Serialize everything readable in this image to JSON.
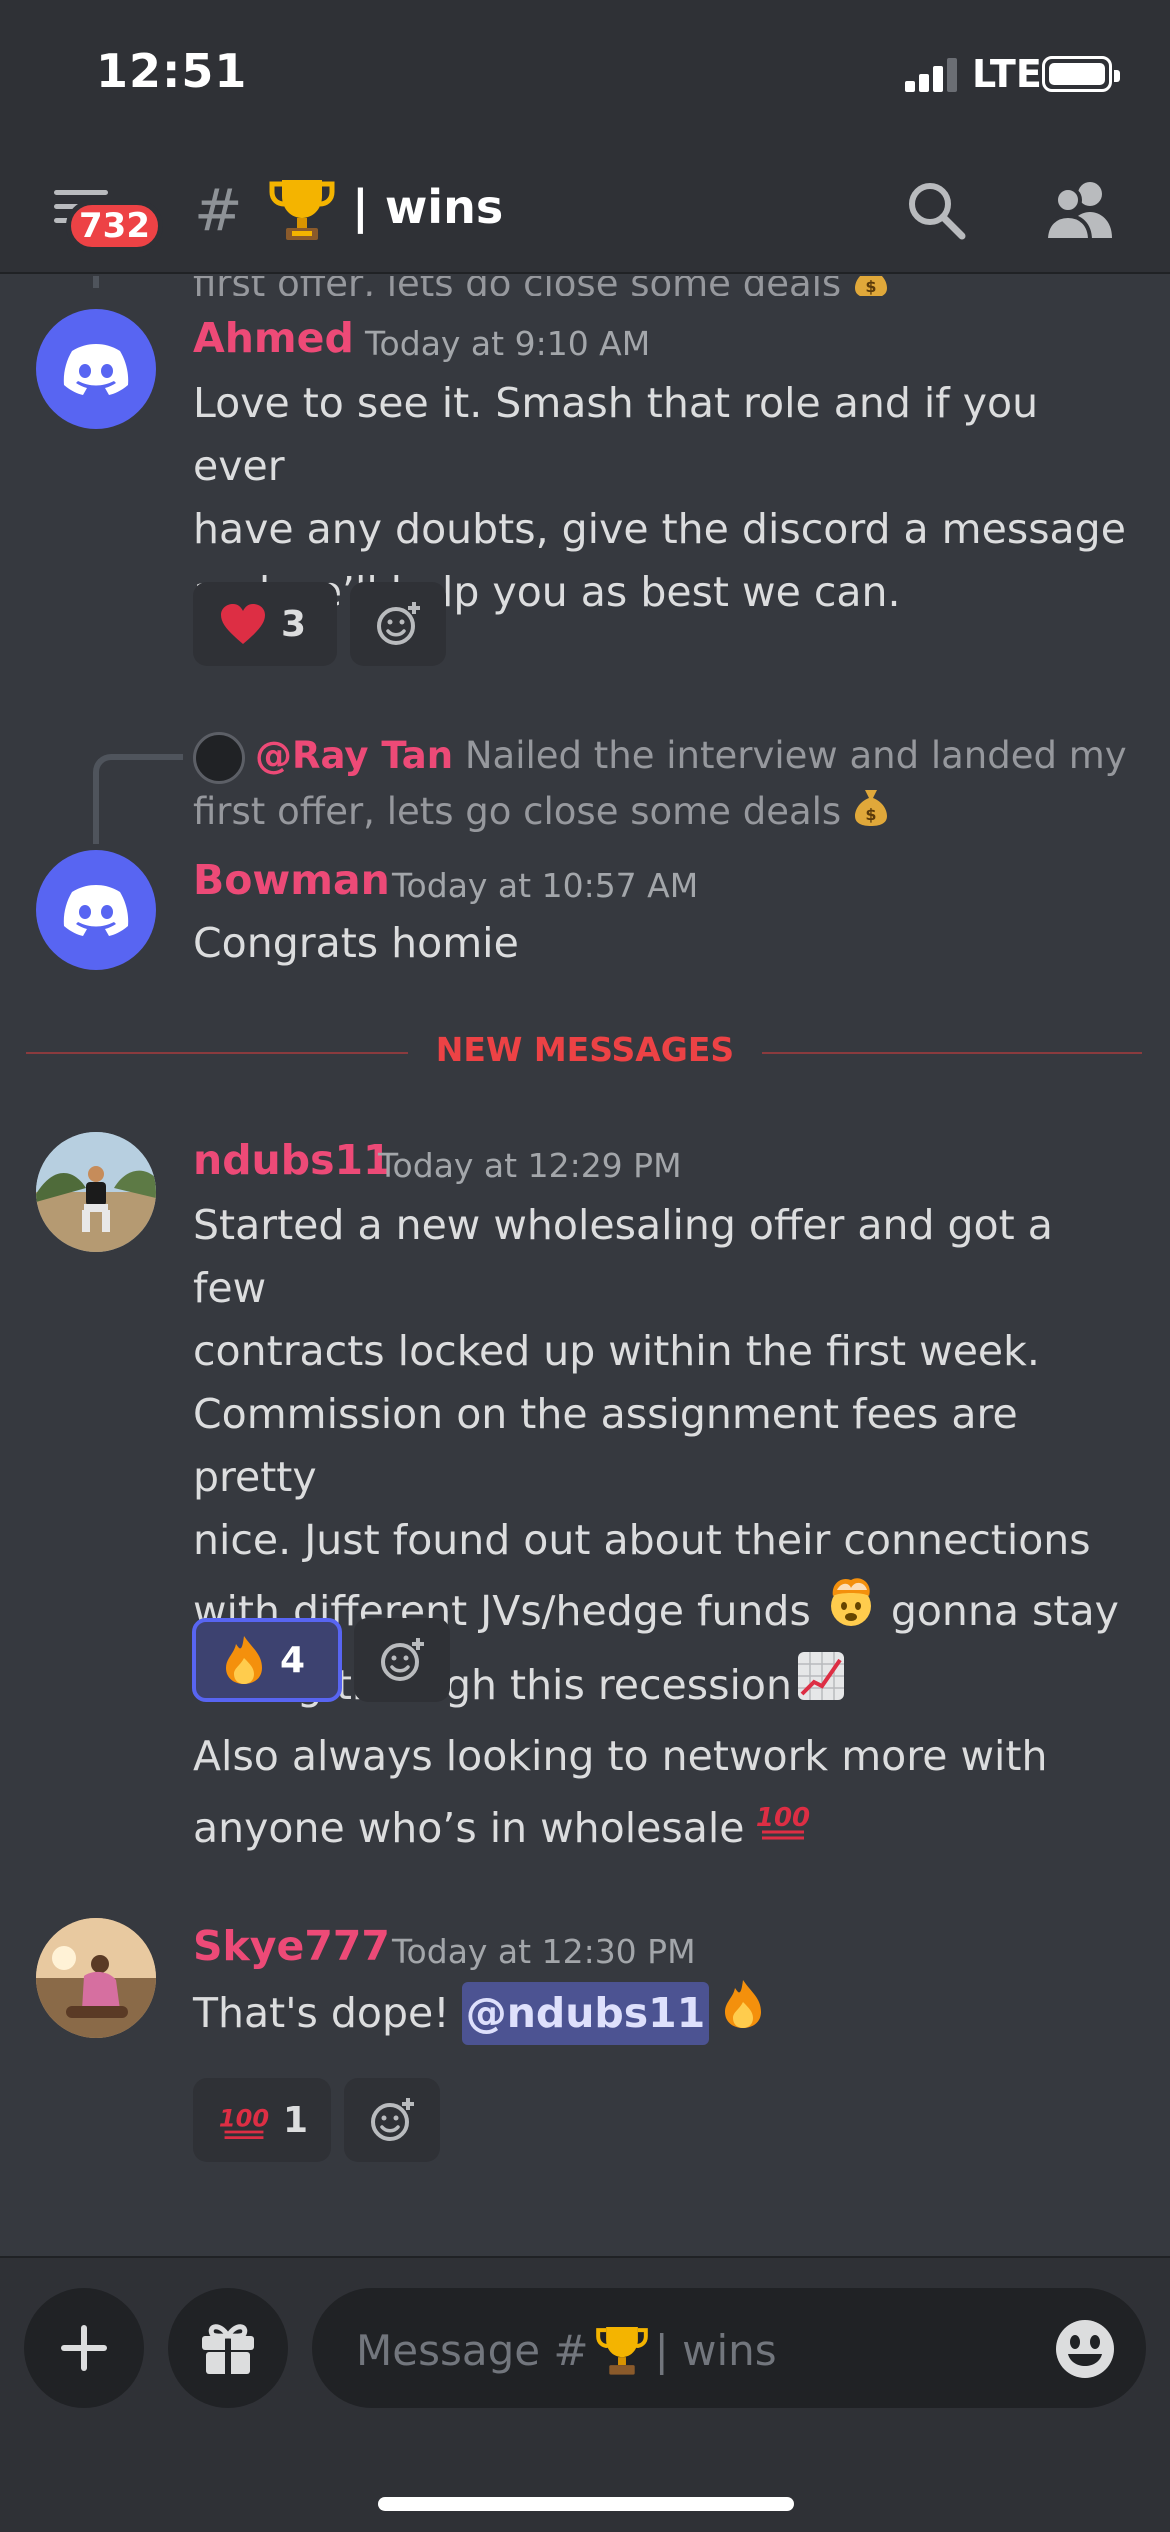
{
  "status_bar": {
    "time": "12:51",
    "network": "LTE"
  },
  "header": {
    "unread_count": "732",
    "channel_prefix": "#",
    "channel_name": "| wins"
  },
  "messages": [
    {
      "reply_preview_tail": "first offer, lets go close some deals",
      "author": "Ahmed",
      "timestamp": "Today at 9:10 AM",
      "lines": [
        "Love to see it. Smash that role and if you ever",
        "have any doubts, give the discord a message",
        "and we’ll help you as best we can."
      ],
      "reactions": [
        {
          "emoji": "heart",
          "count": "3"
        }
      ]
    },
    {
      "reply_to": "@Ray Tan",
      "reply_text_1": "Nailed the interview and landed my",
      "reply_text_2": "first offer, lets go close some deals",
      "author": "Bowman",
      "timestamp": "Today at 10:57 AM",
      "lines": [
        "Congrats homie"
      ]
    },
    {
      "author": "ndubs11",
      "timestamp": "Today at 12:29 PM",
      "lines": [
        "Started a new wholesaling offer and got a few",
        "contracts locked up within the first week.",
        "Commission on the assignment fees are pretty",
        "nice. Just found out about their connections",
        "with different JVs/hedge funds",
        "gonna stay",
        "eating through this recession"
      ],
      "reactions": [
        {
          "emoji": "fire",
          "count": "4",
          "active": true
        }
      ],
      "followup_lines": [
        "Also always looking to network more with",
        "anyone who’s in wholesale"
      ]
    },
    {
      "author": "Skye777",
      "timestamp": "Today at 12:30 PM",
      "text_before": "That's dope!",
      "mention": "@ndubs11",
      "reactions": [
        {
          "emoji": "hundred",
          "count": "1"
        }
      ]
    }
  ],
  "divider_label": "NEW MESSAGES",
  "composer": {
    "placeholder_prefix": "Message #",
    "placeholder_suffix": "| wins"
  },
  "colors": {
    "background": "#36393f",
    "header": "#2f3136",
    "author": "#ed4a77",
    "new_messages": "#ed4245",
    "blurple": "#5865f2"
  },
  "icons": [
    "menu-icon",
    "hash-icon",
    "trophy-icon",
    "search-icon",
    "members-icon",
    "add-reaction-icon",
    "plus-icon",
    "gift-icon",
    "emoji-icon"
  ]
}
